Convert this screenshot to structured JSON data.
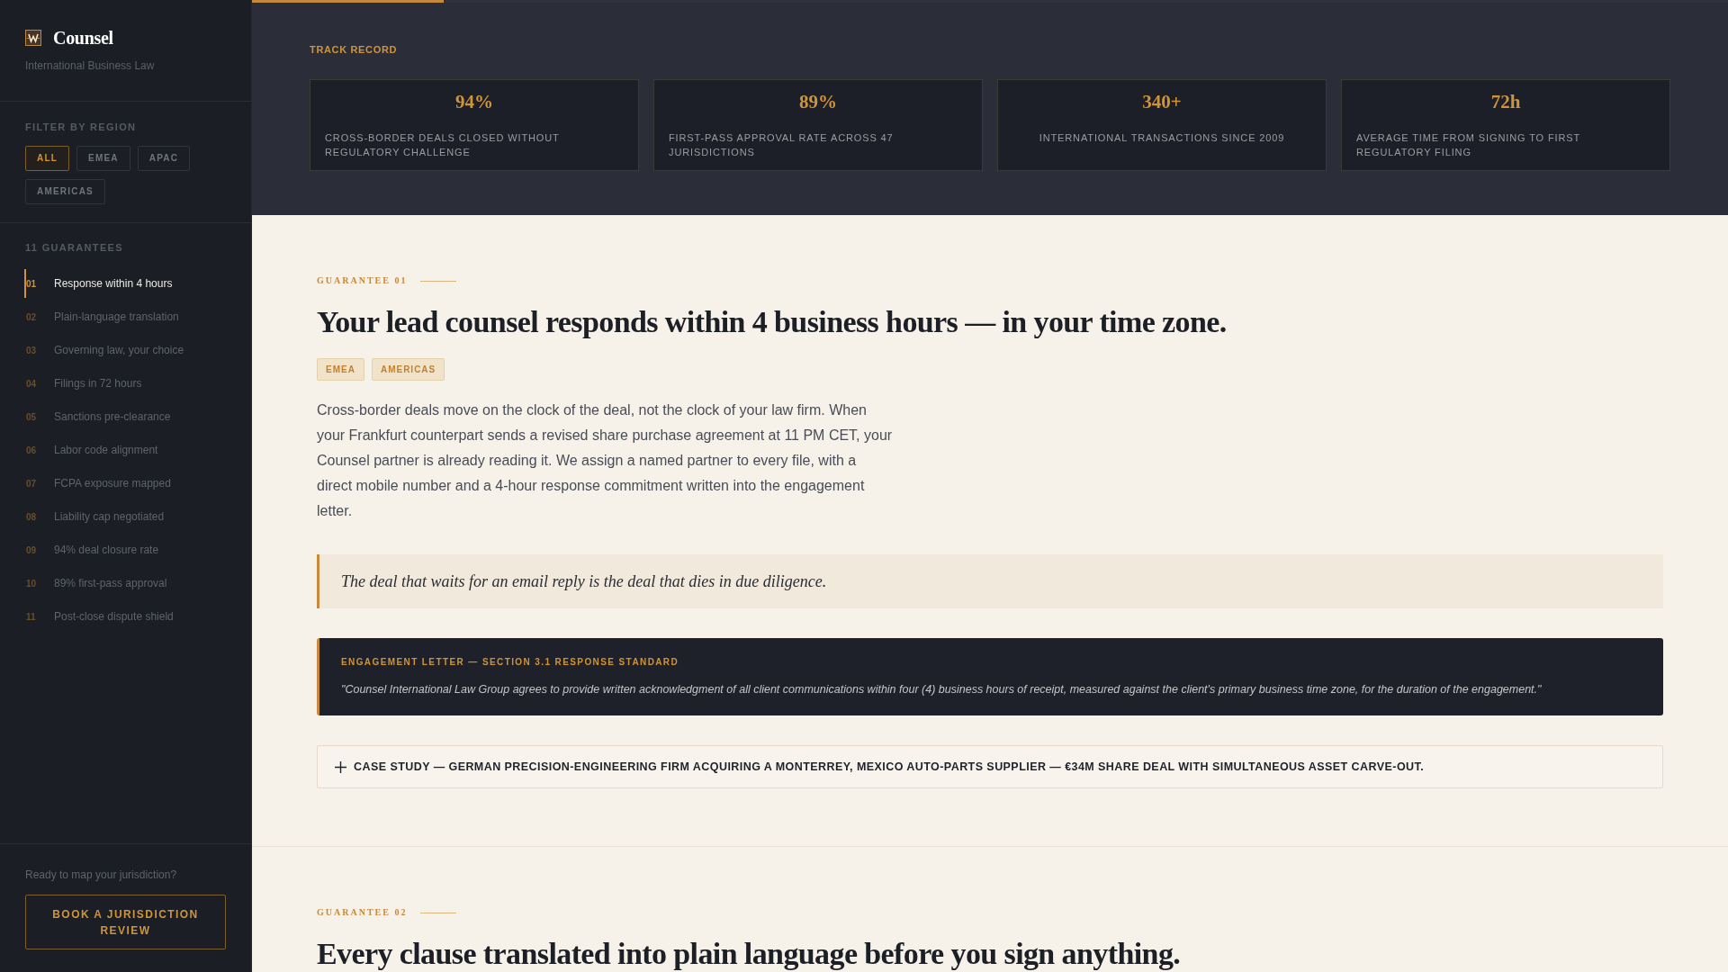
{
  "sidebar": {
    "brand": {
      "name": "Counsel",
      "tagline": "International Business Law"
    },
    "filter": {
      "title": "FILTER BY REGION",
      "options": [
        {
          "label": "ALL",
          "selected": true
        },
        {
          "label": "EMEA",
          "selected": false
        },
        {
          "label": "APAC",
          "selected": false
        },
        {
          "label": "AMERICAS",
          "selected": false
        }
      ]
    },
    "guarantees": {
      "title": "11 GUARANTEES",
      "items": [
        {
          "number": "01",
          "label": "Response within 4 hours",
          "selected": true
        },
        {
          "number": "02",
          "label": "Plain-language translation",
          "selected": false
        },
        {
          "number": "03",
          "label": "Governing law, your choice",
          "selected": false
        },
        {
          "number": "04",
          "label": "Filings in 72 hours",
          "selected": false
        },
        {
          "number": "05",
          "label": "Sanctions pre-clearance",
          "selected": false
        },
        {
          "number": "06",
          "label": "Labor code alignment",
          "selected": false
        },
        {
          "number": "07",
          "label": "FCPA exposure mapped",
          "selected": false
        },
        {
          "number": "08",
          "label": "Liability cap negotiated",
          "selected": false
        },
        {
          "number": "09",
          "label": "94% deal closure rate",
          "selected": false
        },
        {
          "number": "10",
          "label": "89% first-pass approval",
          "selected": false
        },
        {
          "number": "11",
          "label": "Post-close dispute shield",
          "selected": false
        }
      ]
    },
    "cta": {
      "prompt": "Ready to map your jurisdiction?",
      "button": "BOOK A JURISDICTION REVIEW"
    }
  },
  "reading_progress": {
    "level": 0.13
  },
  "track_record": {
    "title": "TRACK RECORD",
    "stats": [
      {
        "value": "94%",
        "label": "CROSS-BORDER DEALS CLOSED WITHOUT REGULATORY CHALLENGE"
      },
      {
        "value": "89%",
        "label": "FIRST-PASS APPROVAL RATE ACROSS 47 JURISDICTIONS"
      },
      {
        "value": "340+",
        "label": "INTERNATIONAL TRANSACTIONS SINCE 2009"
      },
      {
        "value": "72h",
        "label": "AVERAGE TIME FROM SIGNING TO FIRST REGULATORY FILING"
      }
    ]
  },
  "sections": [
    {
      "eyebrow": "GUARANTEE 01",
      "heading": "Your lead counsel responds within 4 business hours — in your time zone.",
      "tags": [
        "EMEA",
        "AMERICAS"
      ],
      "body": "Cross-border deals move on the clock of the deal, not the clock of your law firm. When your Frankfurt counterpart sends a revised share purchase agreement at 11 PM CET, your Counsel partner is already reading it. We assign a named partner to every file, with a direct mobile number and a 4-hour response commitment written into the engagement letter.",
      "pull_quote": "The deal that waits for an email reply is the deal that dies in due diligence.",
      "clause": {
        "title": "ENGAGEMENT LETTER — SECTION 3.1 RESPONSE STANDARD",
        "text": "\"Counsel International Law Group agrees to provide written acknowledgment of all client communications within four (4) business hours of receipt, measured against the client's primary business time zone, for the duration of the engagement.\""
      },
      "case_study": {
        "title": "CASE STUDY — GERMAN PRECISION-ENGINEERING FIRM ACQUIRING A MONTERREY, MEXICO AUTO-PARTS SUPPLIER — €34M SHARE DEAL WITH SIMULTANEOUS ASSET CARVE-OUT.",
        "expanded": false
      }
    },
    {
      "eyebrow": "GUARANTEE 02",
      "heading": "Every clause translated into plain language before you sign anything."
    }
  ]
}
